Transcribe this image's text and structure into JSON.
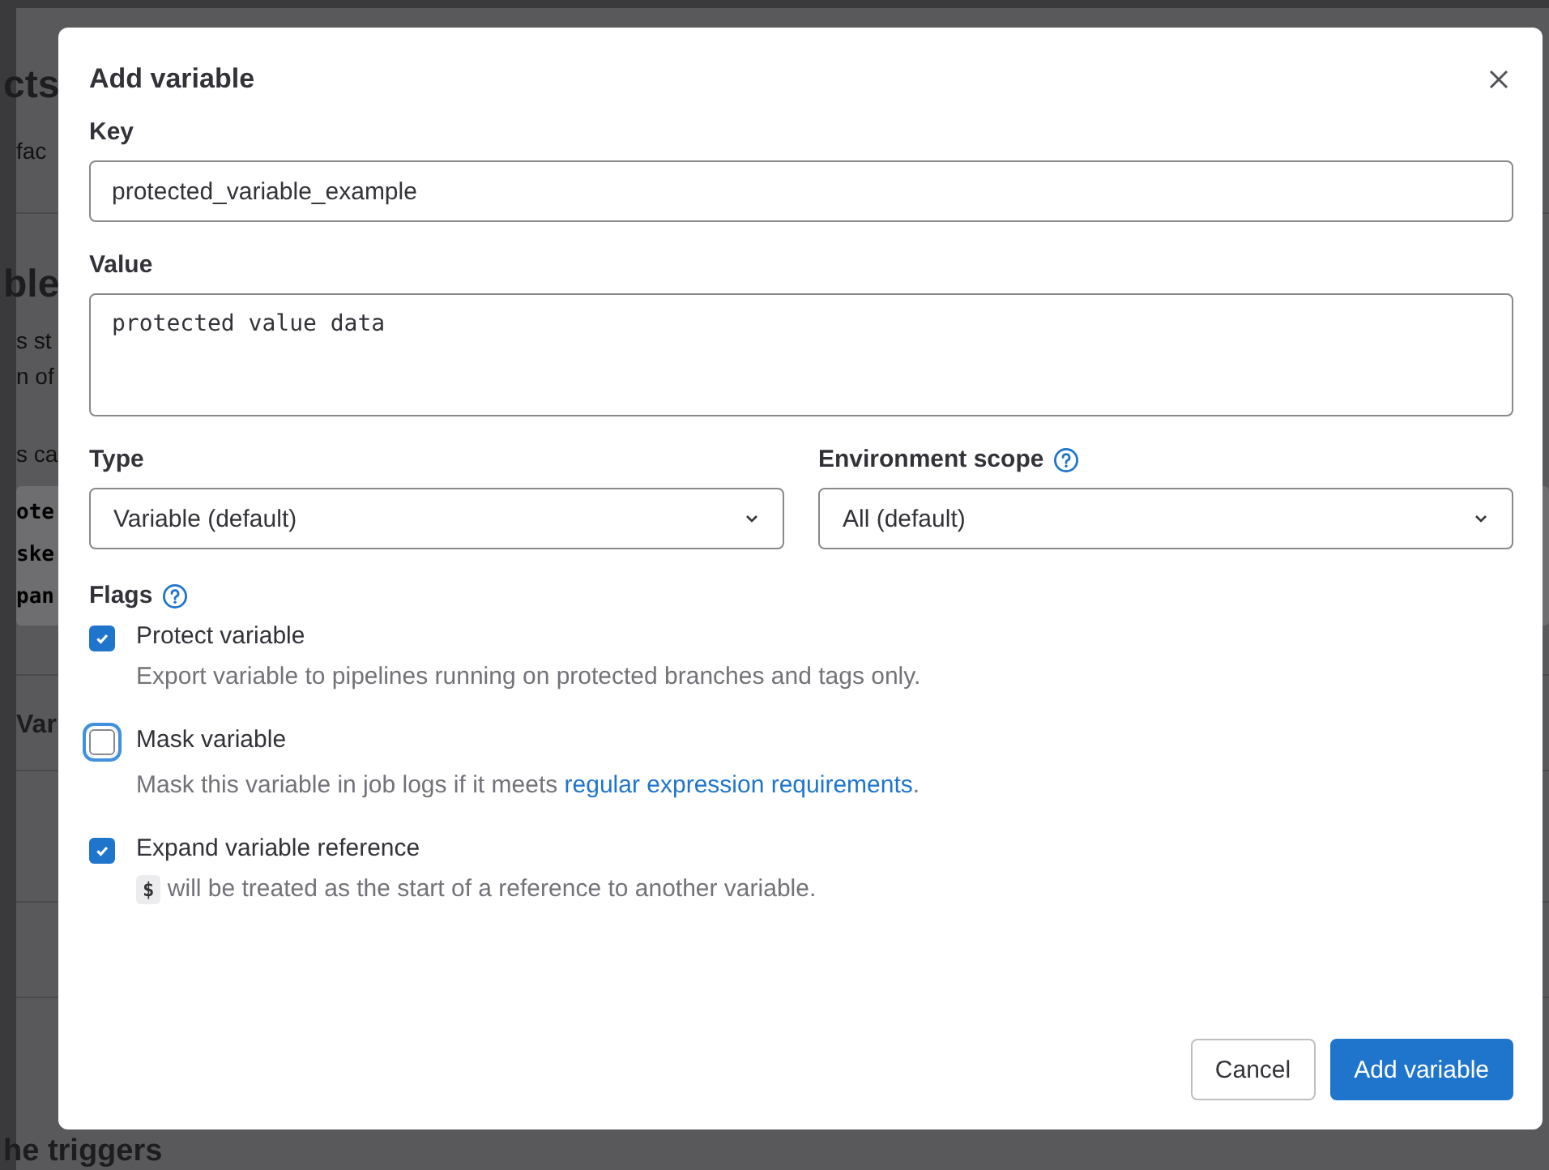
{
  "background_page": [
    {
      "kind": "heading",
      "text": "cts"
    },
    {
      "kind": "text",
      "text": "fac"
    },
    {
      "kind": "rule"
    },
    {
      "kind": "heading",
      "text": "ble"
    },
    {
      "kind": "text",
      "text": "s st"
    },
    {
      "kind": "text",
      "text": "n of"
    },
    {
      "kind": "text",
      "text": "s ca"
    },
    {
      "kind": "code",
      "lines": [
        "ote",
        "ske",
        "pan"
      ]
    },
    {
      "kind": "rule"
    },
    {
      "kind": "subheading",
      "text": "Var"
    },
    {
      "kind": "rule"
    },
    {
      "kind": "rule"
    },
    {
      "kind": "rule"
    },
    {
      "kind": "heading",
      "text": "he triggers"
    }
  ],
  "modal": {
    "title": "Add variable",
    "key": {
      "label": "Key",
      "value": "protected_variable_example"
    },
    "value": {
      "label": "Value",
      "value": "protected value data"
    },
    "type": {
      "label": "Type",
      "value": "Variable (default)"
    },
    "environment_scope": {
      "label": "Environment scope",
      "value": "All (default)"
    },
    "flags": {
      "label": "Flags",
      "items": [
        {
          "label": "Protect variable",
          "checked": true,
          "focused": false,
          "help": [
            {
              "kind": "text",
              "text": "Export variable to pipelines running on protected branches and tags only."
            }
          ]
        },
        {
          "label": "Mask variable",
          "checked": false,
          "focused": true,
          "help": [
            {
              "kind": "text",
              "text": "Mask this variable in job logs if it meets "
            },
            {
              "kind": "link",
              "text": "regular expression requirements"
            },
            {
              "kind": "text",
              "text": "."
            }
          ]
        },
        {
          "label": "Expand variable reference",
          "checked": true,
          "focused": false,
          "help": [
            {
              "kind": "code",
              "text": "$"
            },
            {
              "kind": "text",
              "text": " will be treated as the start of a reference to another variable."
            }
          ]
        }
      ]
    },
    "buttons": [
      {
        "label": "Cancel",
        "kind": "secondary"
      },
      {
        "label": "Add variable",
        "kind": "primary"
      }
    ]
  }
}
